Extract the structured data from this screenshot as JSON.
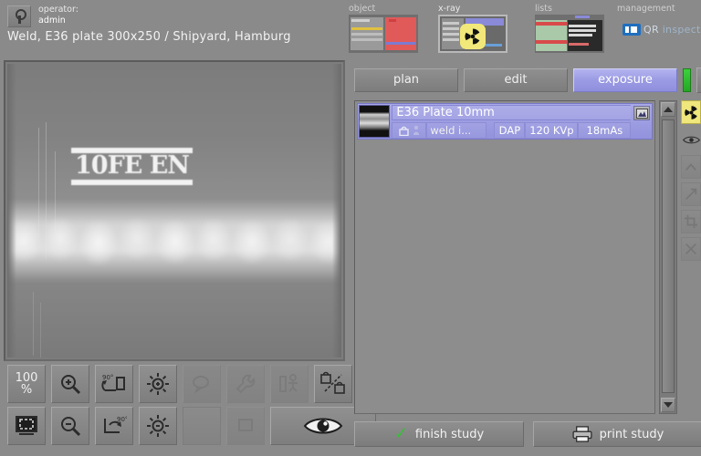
{
  "header": {
    "operator_label": "operator:",
    "operator_name": "admin",
    "operator_icon": "key-icon",
    "study_description": "Weld, E36 plate 300x250 / Shipyard, Hamburg"
  },
  "nav": {
    "tabs": [
      {
        "label": "object",
        "icon": "object-list-thumbnail",
        "active": false
      },
      {
        "label": "x-ray",
        "icon": "radiation-trefoil-icon",
        "active": true
      },
      {
        "label": "lists",
        "icon": "lists-table-thumbnail",
        "active": false
      },
      {
        "label": "management",
        "icon": "brand-logo-icon",
        "active": false
      }
    ],
    "brand": {
      "prefix": "QR",
      "suffix": "inspect"
    }
  },
  "viewer": {
    "marker_text": "10FE EN",
    "toolbar_row1": [
      {
        "name": "zoom-100-percent-button",
        "label_top": "100",
        "label_bottom": "%",
        "icon": "zoom-100-icon",
        "enabled": true
      },
      {
        "name": "zoom-in-button",
        "icon": "magnifier-plus-icon",
        "enabled": true
      },
      {
        "name": "rotate-cw-button",
        "icon": "rotate-90-cw-icon",
        "label": "90°",
        "enabled": true
      },
      {
        "name": "brightness-up-button",
        "icon": "brightness-plus-icon",
        "enabled": true
      },
      {
        "name": "annotate-button",
        "icon": "comment-bubble-icon",
        "enabled": false
      },
      {
        "name": "tools-button",
        "icon": "wrench-icon",
        "enabled": false
      },
      {
        "name": "measure-button",
        "icon": "measure-person-icon",
        "enabled": false
      },
      {
        "name": "link-lock-button",
        "icon": "linked-locks-icon",
        "enabled": true
      }
    ],
    "toolbar_row2": [
      {
        "name": "fit-to-window-button",
        "icon": "fit-screen-icon",
        "enabled": true
      },
      {
        "name": "zoom-out-button",
        "icon": "magnifier-minus-icon",
        "enabled": true
      },
      {
        "name": "rotate-ccw-button",
        "icon": "rotate-90-ccw-icon",
        "label": "90°",
        "enabled": true
      },
      {
        "name": "brightness-down-button",
        "icon": "brightness-minus-icon",
        "enabled": true
      },
      {
        "name": "empty-slot",
        "icon": "none",
        "enabled": false
      },
      {
        "name": "window-level-button",
        "icon": "window-level-icon",
        "enabled": false
      },
      {
        "name": "preview-eye-button",
        "icon": "eye-icon",
        "enabled": true
      }
    ]
  },
  "right_panel": {
    "modes": [
      {
        "label": "plan",
        "active": false
      },
      {
        "label": "edit",
        "active": false
      },
      {
        "label": "exposure",
        "active": true
      }
    ],
    "status_indicator": {
      "name": "ready-status-bar",
      "color": "#2ebd2e"
    },
    "expand_button_icon": "expand-arrows-icon",
    "study": {
      "title": "E36 Plate 10mm",
      "thumbnail": "radiograph-thumbnail",
      "lock_icon": "lock-icon",
      "person_icon": "person-icon",
      "description": "weld i...",
      "dose_label": "DAP",
      "kvp": "120 KVp",
      "mas": "18mAs",
      "detail_button_icon": "image-detail-icon"
    },
    "scrollbar": {
      "up_icon": "triangle-up-icon",
      "down_icon": "triangle-down-icon"
    },
    "rail": [
      {
        "name": "radiation-active-icon",
        "active": true,
        "dim": false
      },
      {
        "name": "eye-icon",
        "active": false,
        "dim": false
      },
      {
        "name": "collapse-up-icon",
        "active": false,
        "dim": true
      },
      {
        "name": "expand-diagonal-icon",
        "active": false,
        "dim": true
      },
      {
        "name": "crop-icon",
        "active": false,
        "dim": true
      },
      {
        "name": "cut-icon",
        "active": false,
        "dim": true
      }
    ],
    "actions": [
      {
        "label": "finish study",
        "icon": "green-check-icon"
      },
      {
        "label": "print study",
        "icon": "printer-icon"
      }
    ]
  },
  "colors": {
    "background": "#8a8a8a",
    "accent_active_tab": "#9a9ae4",
    "status_green": "#2ebd2e",
    "radiation_yellow": "#efe67c",
    "brand_blue": "#1f6fbf"
  }
}
